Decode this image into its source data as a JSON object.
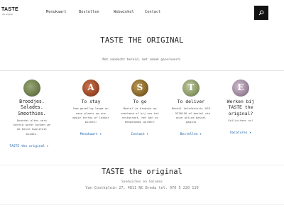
{
  "header": {
    "logo_main": "TASTE",
    "logo_sub": "the original",
    "nav": [
      {
        "label": "Menukaart"
      },
      {
        "label": "Bestellen"
      },
      {
        "label": "Webwinkel"
      },
      {
        "label": "Contact"
      }
    ],
    "search_icon": "search-icon"
  },
  "hero": {
    "title": "TASTE THE ORIGINAL",
    "tagline": "Met aandacht bereid, met smaak geserveerd."
  },
  "cards": [
    {
      "letter": "",
      "image_color": "#6f7f4e",
      "title": "Broodjes. Salades. Smoothies.",
      "body": "Doordat altes vers bereid wordt kunnen we de beste kwaliteit bieden.",
      "link": "TASTE the original",
      "arrow": "▸"
    },
    {
      "letter": "A",
      "image_color": "#a04a2a",
      "title": "To stay",
      "body": "Kom gezellig lange on ease plaats op ons mooie terras of lekker binnen!",
      "link": "Menukaart",
      "arrow": "▸"
    },
    {
      "letter": "S",
      "image_color": "#8a6a2a",
      "title": "To go",
      "body": "Bestel je broodje op voorhand of bij ons het restaurant, het kan zo meegenomen worden!",
      "link": "Contact",
      "arrow": "▸"
    },
    {
      "letter": "T",
      "image_color": "#8e9c6a",
      "title": "To deliver",
      "body": "Bestel telefonisch: 076 - 5220110 of bestel via onze online bestel pagina",
      "link": "Bestellen",
      "arrow": "▸"
    },
    {
      "letter": "E",
      "image_color": "#a08aa0",
      "title": "Werken bij TASTE the original?",
      "body": "Solliciteer nu!",
      "link": "Vacatures",
      "arrow": "▸"
    }
  ],
  "footer": {
    "title": "TASTE the original",
    "subtitle": "Sandwiches en Salades",
    "address": "Van Coothplein 27, 4811 NC Breda tel. 076 5 220 110"
  }
}
